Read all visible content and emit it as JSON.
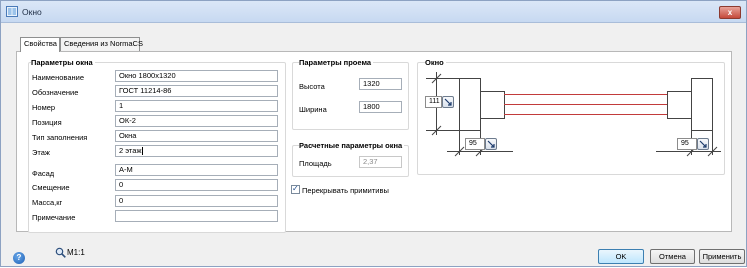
{
  "window": {
    "title": "Окно",
    "close_label": "x"
  },
  "tabs": [
    {
      "label": "Свойства",
      "active": true
    },
    {
      "label": "Сведения из NormaCS",
      "active": false
    }
  ],
  "window_params": {
    "title": "Параметры окна",
    "fields": [
      {
        "label": "Наименование",
        "value": "Окно 1800x1320"
      },
      {
        "label": "Обозначение",
        "value": "ГОСТ 11214-86"
      },
      {
        "label": "Номер",
        "value": "1"
      },
      {
        "label": "Позиция",
        "value": "ОК-2"
      },
      {
        "label": "Тип заполнения",
        "value": "Окна"
      },
      {
        "label": "Этаж",
        "value": "2 этаж"
      },
      {
        "label": "Фасад",
        "value": "А-М"
      },
      {
        "label": "Смещение",
        "value": "0"
      },
      {
        "label": "Масса,кг",
        "value": "0"
      },
      {
        "label": "Примечание",
        "value": ""
      }
    ]
  },
  "opening_params": {
    "title": "Параметры проема",
    "height_label": "Высота",
    "height_value": "1320",
    "width_label": "Ширина",
    "width_value": "1800"
  },
  "calc_params": {
    "title": "Расчетные параметры окна",
    "area_label": "Площадь",
    "area_value": "2,37"
  },
  "overlap_checkbox": {
    "label": "Перекрывать примитивы",
    "checked": true
  },
  "window_diagram": {
    "title": "Окно",
    "left_offset": "111",
    "bottom_left_offset": "95",
    "bottom_right_offset": "95",
    "colors": {
      "lines": "#555555",
      "accent": "#c23b3b"
    }
  },
  "footer": {
    "help_label": "?",
    "scale_label": "M1:1",
    "ok_label": "OK",
    "cancel_label": "Отмена",
    "apply_label": "Применить"
  }
}
